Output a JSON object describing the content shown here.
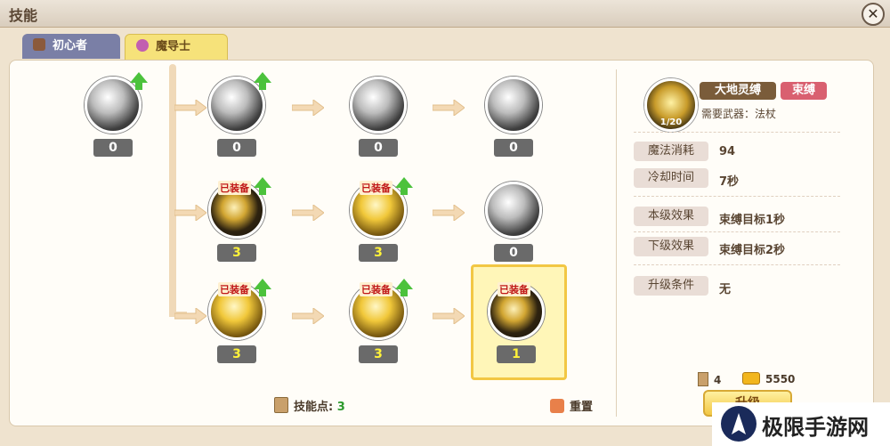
{
  "window": {
    "title": "技能",
    "close_label": "✕"
  },
  "tabs": [
    {
      "label": "初心者",
      "active": false
    },
    {
      "label": "魔导士",
      "active": true
    }
  ],
  "skills": {
    "root": {
      "level": "0",
      "has_upgrade": true
    },
    "row1": [
      {
        "level": "0",
        "has_upgrade": true
      },
      {
        "level": "0"
      },
      {
        "level": "0"
      }
    ],
    "row2": [
      {
        "level": "3",
        "equipped": "已装备",
        "has_upgrade": true
      },
      {
        "level": "3",
        "equipped": "已装备",
        "has_upgrade": true
      },
      {
        "level": "0"
      }
    ],
    "row3": [
      {
        "level": "3",
        "equipped": "已装备",
        "has_upgrade": true
      },
      {
        "level": "3",
        "equipped": "已装备",
        "has_upgrade": true
      },
      {
        "level": "1",
        "equipped": "已装备",
        "selected": true
      }
    ]
  },
  "footer": {
    "skill_points_label": "技能点:",
    "skill_points_value": "3",
    "reset_label": "重置"
  },
  "detail": {
    "icon_level": "1/20",
    "name": "大地灵缚",
    "type": "束缚",
    "weapon_label": "需要武器：法杖",
    "mana_label": "魔法消耗",
    "mana_value": "94",
    "cooldown_label": "冷却时间",
    "cooldown_value": "7秒",
    "current_label": "本级效果",
    "current_value": "束缚目标1秒",
    "next_label": "下级效果",
    "next_value": "束缚目标2秒",
    "req_label": "升级条件",
    "req_value": "无",
    "books": "4",
    "gold": "5550",
    "upgrade_label": "升级"
  },
  "watermark": {
    "text": "极限手游网"
  },
  "colors": {
    "accent_gold": "#f2c744",
    "level_yellow": "#fff23a",
    "upgrade_green": "#4cc23c",
    "equipped_red": "#c01818"
  }
}
